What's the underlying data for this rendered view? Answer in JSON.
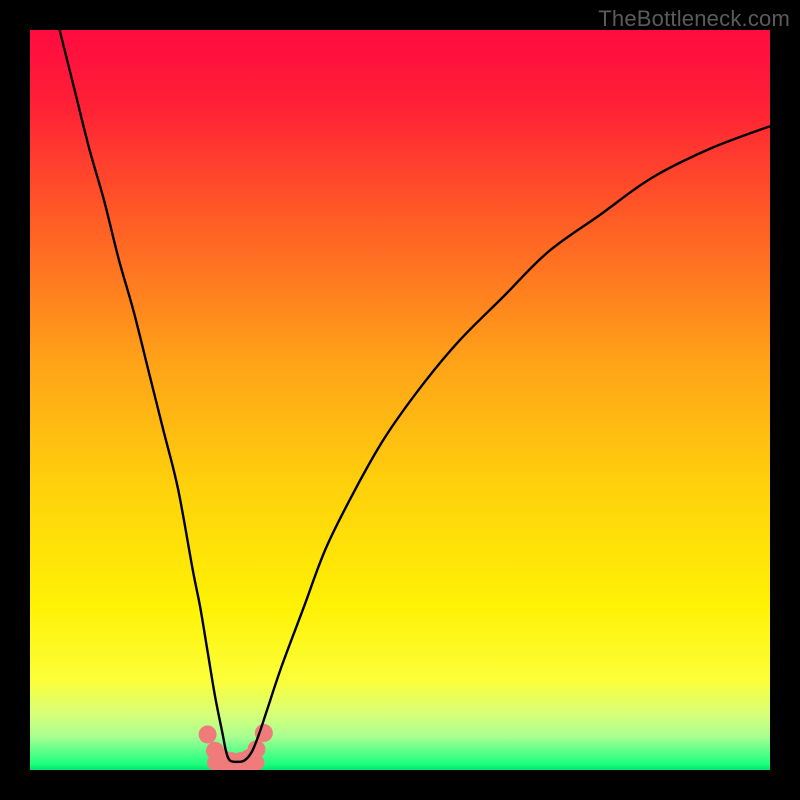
{
  "watermark": "TheBottleneck.com",
  "chart_data": {
    "type": "line",
    "title": "",
    "xlabel": "",
    "ylabel": "",
    "xlim": [
      0,
      100
    ],
    "ylim": [
      0,
      100
    ],
    "grid": false,
    "legend": false,
    "gradient_stops": [
      {
        "pos": 0.0,
        "color": "#ff0b40"
      },
      {
        "pos": 0.1,
        "color": "#ff2036"
      },
      {
        "pos": 0.25,
        "color": "#ff5a26"
      },
      {
        "pos": 0.45,
        "color": "#ffa318"
      },
      {
        "pos": 0.62,
        "color": "#ffd20b"
      },
      {
        "pos": 0.78,
        "color": "#fff205"
      },
      {
        "pos": 0.88,
        "color": "#fbff3a"
      },
      {
        "pos": 0.925,
        "color": "#d7ff79"
      },
      {
        "pos": 0.955,
        "color": "#a8ff91"
      },
      {
        "pos": 0.975,
        "color": "#5bff8a"
      },
      {
        "pos": 0.992,
        "color": "#1dff7e"
      },
      {
        "pos": 1.0,
        "color": "#03e56b"
      }
    ],
    "series": [
      {
        "name": "bottleneck-curve",
        "color": "#000000",
        "x": [
          4,
          6,
          8,
          10,
          12,
          14,
          16,
          18,
          20,
          22,
          23,
          24,
          25,
          26,
          26.5,
          27,
          28,
          29,
          30,
          31,
          32,
          34,
          37,
          40,
          44,
          48,
          53,
          58,
          64,
          70,
          77,
          84,
          92,
          100
        ],
        "y": [
          100,
          92,
          84,
          77,
          69,
          62,
          54,
          46,
          38,
          27,
          22,
          16,
          10,
          5,
          2.5,
          1.3,
          1.1,
          1.3,
          2.5,
          5,
          8,
          14,
          22,
          30,
          38,
          45,
          52,
          58,
          64,
          70,
          75,
          80,
          84,
          87
        ]
      },
      {
        "name": "valley-markers",
        "type": "scatter",
        "color": "#ef7b7b",
        "marker_radius": 9,
        "x": [
          24.0,
          25.0,
          26.0,
          27.2,
          28.5,
          29.6,
          30.6,
          31.6
        ],
        "y": [
          4.8,
          2.6,
          1.6,
          1.2,
          1.2,
          1.6,
          2.8,
          5.0
        ]
      }
    ],
    "valley_bar": {
      "color": "#ef7b7b",
      "x_start": 25.0,
      "x_end": 30.6,
      "y": 1.0,
      "thickness": 16
    }
  }
}
